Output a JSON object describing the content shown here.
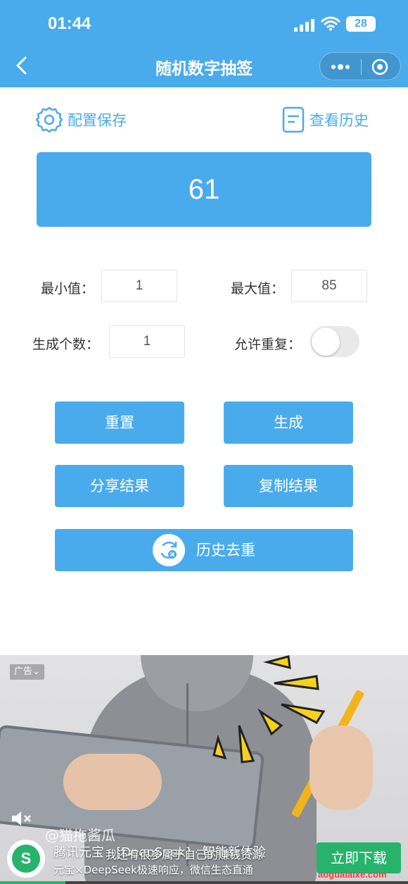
{
  "status": {
    "time": "01:44",
    "battery": "28"
  },
  "nav": {
    "title": "随机数字抽签"
  },
  "actions": {
    "config": "配置保存",
    "history": "查看历史"
  },
  "result": {
    "value": "61"
  },
  "form": {
    "min_label": "最小值：",
    "min_value": "1",
    "max_label": "最大值：",
    "max_value": "85",
    "count_label": "生成个数：",
    "count_value": "1",
    "repeat_label": "允许重复：",
    "repeat_enabled": false
  },
  "buttons": {
    "reset": "重置",
    "generate": "生成",
    "share": "分享结果",
    "copy": "复制结果",
    "dedupe": "历史去重"
  },
  "ad": {
    "tag": "广告⌄",
    "watermark": "@猫拖酱瓜",
    "title": "腾讯元宝 · [DeepSeek] · 智能新体验",
    "subtitle": "元宝×DeepSeek极速响应，微信生态直通",
    "caption": "我还有很多属于自己的赚钱资源",
    "download": "立即下载",
    "corner": "aoguaiaixe.com",
    "logo_letter": "S",
    "progress": 0.16
  },
  "colors": {
    "primary": "#4aabec",
    "toggle_off": "#e9e9e9",
    "ad_green": "#27b36b"
  },
  "icons": [
    "back-arrow-icon",
    "more-dots-icon",
    "target-icon",
    "gear-icon",
    "document-icon",
    "dedupe-cycle-icon",
    "mute-icon"
  ]
}
